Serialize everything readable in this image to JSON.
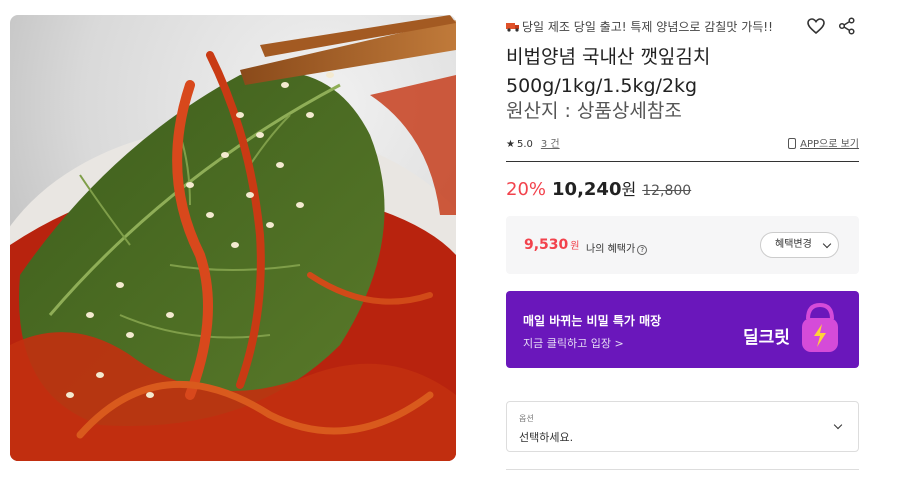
{
  "product_image": {
    "alt": "perilla leaf kimchi held with chopsticks"
  },
  "promo": {
    "icon": "truck-icon",
    "text": "당일 제조 당일 출고! 특제 양념으로 감칠맛 가득!!"
  },
  "actions": {
    "like_icon": "heart-icon",
    "share_icon": "share-icon"
  },
  "product": {
    "title_line1": "비법양념 국내산 깻잎김치",
    "title_line2": "500g/1kg/1.5kg/2kg",
    "origin": "원산지 : 상품상세참조"
  },
  "rating": {
    "star": "★",
    "score": "5.0",
    "count": "3 건",
    "app_view": "APP으로 보기"
  },
  "price": {
    "discount": "20%",
    "sale": "10,240",
    "unit": "원",
    "original": "12,800"
  },
  "benefit": {
    "price": "9,530",
    "unit": "원",
    "label": "나의 혜택가",
    "help": "?",
    "button": "혜택변경"
  },
  "banner": {
    "headline": "매일 바뀌는 비밀 특가 매장",
    "sub": "지금 클릭하고 입장 >",
    "logo_text": "딜크릿",
    "bg_color": "#6a17bb",
    "accent_color": "#d54bd9"
  },
  "option": {
    "label": "옵션",
    "value": "선택하세요."
  },
  "colors": {
    "discount": "#f2424c",
    "banner": "#6a17bb"
  }
}
